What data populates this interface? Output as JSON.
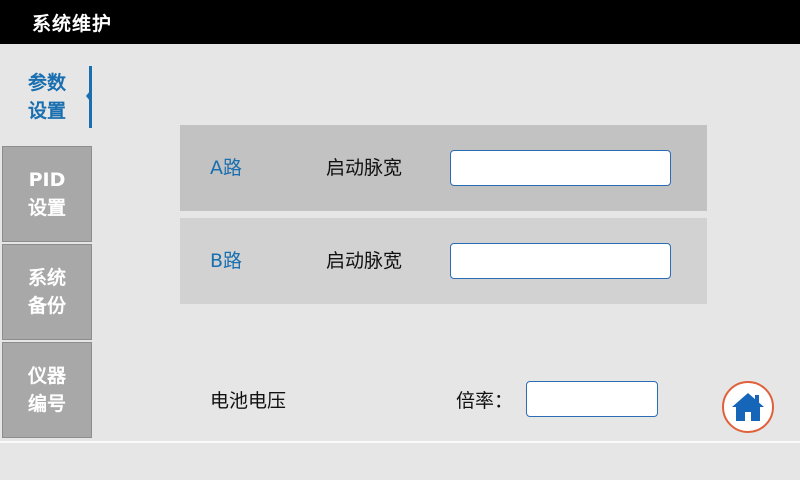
{
  "header": {
    "title": "系统维护"
  },
  "sidebar": {
    "tabs": [
      {
        "line1": "参数",
        "line2": "设置",
        "active": true
      },
      {
        "line1": "PID",
        "line2": "设置",
        "active": false
      },
      {
        "line1": "系统",
        "line2": "备份",
        "active": false
      },
      {
        "line1": "仪器",
        "line2": "编号",
        "active": false
      }
    ]
  },
  "settings": {
    "rows": [
      {
        "channel": "A路",
        "label": "启动脉宽",
        "value": ""
      },
      {
        "channel": "B路",
        "label": "启动脉宽",
        "value": ""
      }
    ],
    "battery": {
      "label": "电池电压",
      "ratio_label": "倍率：",
      "ratio_value": ""
    }
  },
  "colors": {
    "accent": "#1a6fb0",
    "home_ring": "#e0603a",
    "home_icon": "#1565b8"
  },
  "icons": {
    "home": "home-icon"
  }
}
